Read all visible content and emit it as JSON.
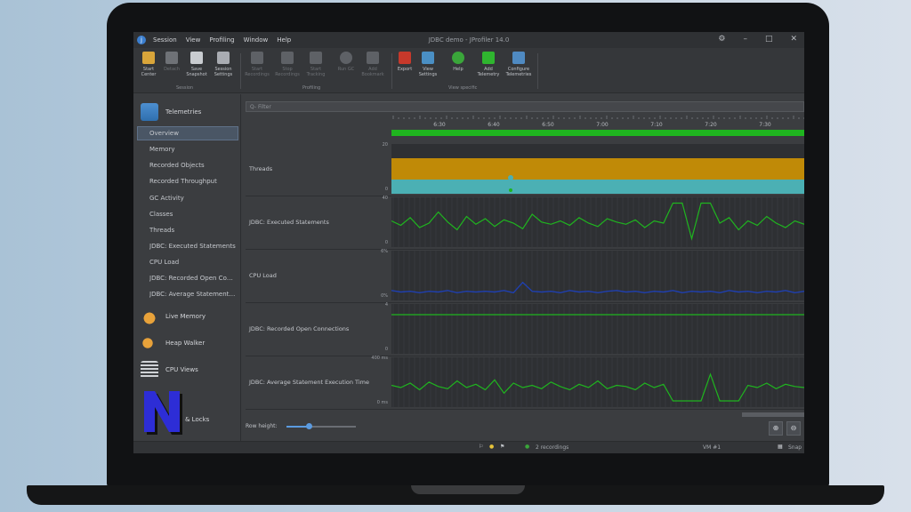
{
  "window": {
    "title": "JDBC demo - JProfiler 14.0",
    "menu": [
      "Session",
      "View",
      "Profiling",
      "Window",
      "Help"
    ]
  },
  "toolbar": {
    "session_group": [
      "Start Center",
      "Detach",
      "Save Snapshot",
      "Session Settings"
    ],
    "session_label": "Session",
    "profiling_group": [
      "Start Recordings",
      "Stop Recordings",
      "Start Tracking",
      "Run GC",
      "Add Bookmark"
    ],
    "profiling_label": "Profiling",
    "view_group": [
      "Export",
      "View Settings",
      "Help",
      "Add Telemetry",
      "Configure Telemetries"
    ],
    "view_label": "View specific"
  },
  "sidebar": {
    "telemetries": "Telemetries",
    "items": [
      "Overview",
      "Memory",
      "Recorded Objects",
      "Recorded Throughput",
      "GC Activity",
      "Classes",
      "Threads",
      "JDBC: Executed Statements",
      "CPU Load",
      "JDBC: Recorded Open Connections",
      "JDBC: Average Statement Execution Time"
    ],
    "live_memory": "Live Memory",
    "heap_walker": "Heap Walker",
    "cpu_views": "CPU Views",
    "locks_partial": "& Locks"
  },
  "filter": {
    "placeholder": "Q- Filter"
  },
  "timeline": {
    "ticks": [
      "6:30",
      "6:40",
      "6:50",
      "7:00",
      "7:10",
      "7:20",
      "7:30"
    ]
  },
  "rows": [
    {
      "label": "",
      "ymax": "",
      "ymin": ""
    },
    {
      "label": "Threads",
      "ymax": "20",
      "ymin": "0"
    },
    {
      "label": "JDBC: Executed Statements",
      "ymax": "40",
      "ymin": "0"
    },
    {
      "label": "CPU Load",
      "ymax": "6%",
      "ymin": "0%"
    },
    {
      "label": "JDBC: Recorded Open Connections",
      "ymax": "4",
      "ymin": "0"
    },
    {
      "label": "JDBC: Average Statement Execution Time",
      "ymax": "400 ms",
      "ymin": "0 ms"
    }
  ],
  "row_height_label": "Row height:",
  "row_height_value": 0.3,
  "status": {
    "recordings": "2 recordings",
    "vm": "VM #1",
    "snap": "Snap"
  },
  "colors": {
    "green": "#1fb51f",
    "orange": "#c08a07",
    "teal": "#4bb0b4",
    "blue": "#1f3fb0",
    "accent": "#5b9be0"
  },
  "chart_data": {
    "type": "line",
    "x_ticks": [
      "6:30",
      "6:40",
      "6:50",
      "7:00",
      "7:10",
      "7:20",
      "7:30"
    ],
    "series": [
      {
        "name": "JDBC: Executed Statements",
        "values": [
          22,
          18,
          25,
          16,
          20,
          30,
          21,
          14,
          26,
          19,
          24,
          17,
          23,
          20,
          15,
          28,
          21,
          19,
          22,
          18,
          25,
          20,
          17,
          24,
          21,
          19,
          23,
          16,
          22,
          20,
          38,
          38,
          6,
          38,
          38,
          20,
          25,
          14,
          22,
          18,
          26,
          20,
          16,
          22,
          19
        ]
      },
      {
        "name": "CPU Load",
        "values": [
          1.1,
          0.9,
          1.0,
          0.8,
          1.0,
          0.9,
          1.1,
          0.8,
          1.0,
          0.9,
          1.0,
          0.9,
          1.1,
          0.8,
          2.2,
          1.0,
          0.9,
          1.0,
          0.8,
          1.1,
          0.9,
          1.0,
          0.8,
          1.0,
          1.1,
          0.9,
          1.0,
          0.8,
          1.0,
          0.9,
          1.1,
          0.8,
          1.0,
          0.9,
          1.0,
          0.8,
          1.1,
          0.9,
          1.0,
          0.8,
          1.0,
          0.9,
          1.1,
          0.8,
          1.0
        ]
      },
      {
        "name": "JDBC: Average Statement Execution Time",
        "values": [
          180,
          160,
          200,
          140,
          210,
          170,
          150,
          220,
          160,
          190,
          140,
          230,
          110,
          200,
          160,
          180,
          150,
          210,
          170,
          140,
          190,
          160,
          220,
          150,
          180,
          170,
          140,
          200,
          160,
          190,
          40,
          40,
          40,
          40,
          280,
          40,
          40,
          40,
          180,
          160,
          200,
          150,
          190,
          170,
          160
        ]
      }
    ]
  }
}
